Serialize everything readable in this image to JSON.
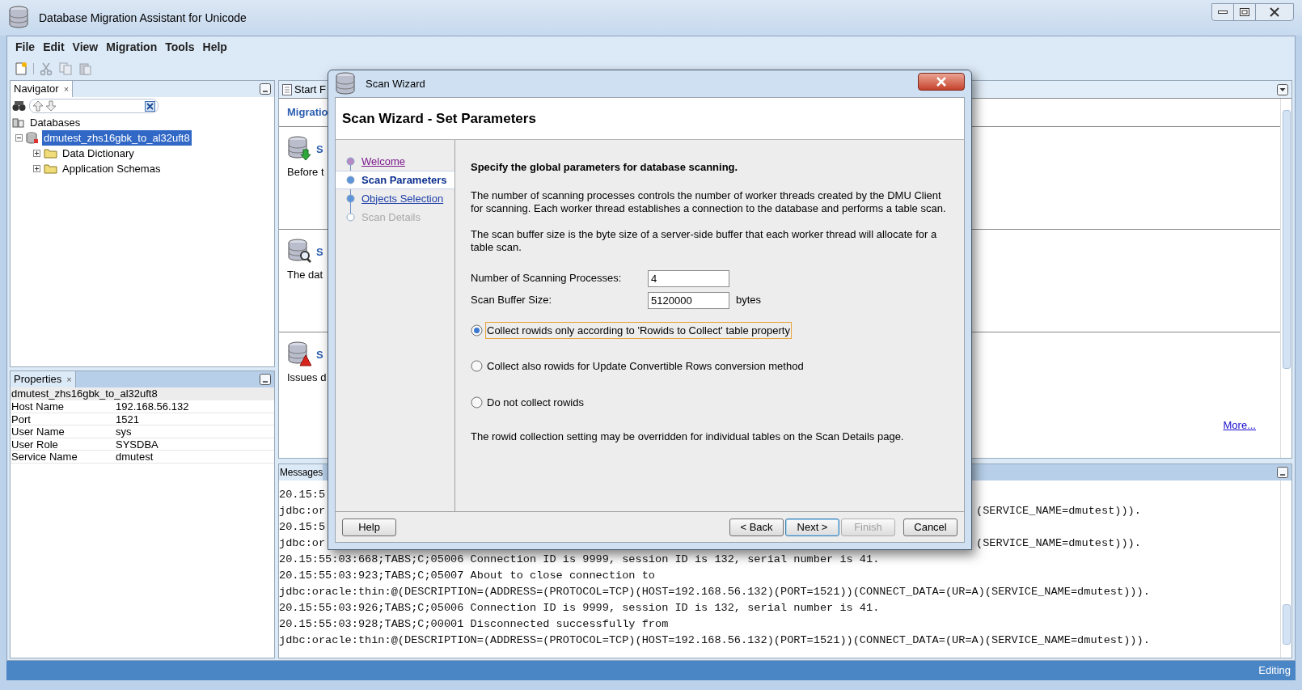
{
  "window": {
    "title": "Database Migration Assistant for Unicode"
  },
  "menu": [
    "File",
    "Edit",
    "View",
    "Migration",
    "Tools",
    "Help"
  ],
  "toolbar": [
    {
      "kind": "new",
      "disabled": false
    },
    {
      "kind": "cut",
      "disabled": true
    },
    {
      "kind": "copy",
      "disabled": true
    },
    {
      "kind": "paste",
      "disabled": true
    }
  ],
  "navigator": {
    "title": "Navigator",
    "close": "×",
    "tree": [
      {
        "label": "Databases",
        "kind": "root",
        "selected": false,
        "expanded": true,
        "children": [
          {
            "label": "dmutest_zhs16gbk_to_al32uft8",
            "kind": "database",
            "selected": true,
            "expanded": true,
            "children": [
              {
                "label": "Data Dictionary",
                "kind": "folder",
                "selected": false,
                "expanded": false
              },
              {
                "label": "Application Schemas",
                "kind": "folder",
                "selected": false,
                "expanded": false
              }
            ]
          }
        ]
      }
    ]
  },
  "properties": {
    "title": "Properties",
    "close": "×",
    "heading": "dmutest_zhs16gbk_to_al32uft8",
    "rows": [
      {
        "name": "Host Name",
        "value": "192.168.56.132"
      },
      {
        "name": "Port",
        "value": "1521"
      },
      {
        "name": "User Name",
        "value": "sys"
      },
      {
        "name": "User Role",
        "value": "SYSDBA"
      },
      {
        "name": "Service Name",
        "value": "dmutest"
      }
    ]
  },
  "start_page": {
    "tab": "Start F",
    "heading": "Migratio",
    "sections": [
      {
        "kind": "convert",
        "title": "S",
        "text": "Before t"
      },
      {
        "kind": "scan",
        "title": "S",
        "text": "The dat"
      },
      {
        "kind": "issues",
        "title": "S",
        "text": "Issues d"
      }
    ],
    "more_link": "More..."
  },
  "messages": {
    "title": "Messages",
    "lines": [
      {
        "left": "20.15:5"
      },
      {
        "left": "jdbc:or",
        "right": "(SERVICE_NAME=dmutest)))."
      },
      {
        "left": "20.15:5"
      },
      {
        "left": "jdbc:or",
        "right": "(SERVICE_NAME=dmutest)))."
      },
      {
        "left": "20.15:55:03:668;TABS;C;05006 Connection ID is 9999, session ID is 132, serial number is 41."
      },
      {
        "left": "20.15:55:03:923;TABS;C;05007 About to close connection to"
      },
      {
        "left": "jdbc:oracle:thin:@(DESCRIPTION=(ADDRESS=(PROTOCOL=TCP)(HOST=192.168.56.132)(PORT=1521))(CONNECT_DATA=(UR=A)(SERVICE_NAME=dmutest)))."
      },
      {
        "left": "20.15:55:03:926;TABS;C;05006 Connection ID is 9999, session ID is 132, serial number is 41."
      },
      {
        "left": "20.15:55:03:928;TABS;C;00001 Disconnected successfully from"
      },
      {
        "left": "jdbc:oracle:thin:@(DESCRIPTION=(ADDRESS=(PROTOCOL=TCP)(HOST=192.168.56.132)(PORT=1521))(CONNECT_DATA=(UR=A)(SERVICE_NAME=dmutest)))."
      }
    ]
  },
  "status_bar": {
    "text": "Editing"
  },
  "dialog": {
    "title": "Scan Wizard",
    "heading": "Scan Wizard - Set Parameters",
    "steps": [
      {
        "label": "Welcome",
        "kind": "visited",
        "selected": false
      },
      {
        "label": "Scan Parameters",
        "kind": "current",
        "selected": true
      },
      {
        "label": "Objects Selection",
        "kind": "link",
        "selected": false
      },
      {
        "label": "Scan Details",
        "kind": "disabled",
        "selected": false
      }
    ],
    "intro": "Specify the global parameters for database scanning.",
    "paragraphs": [
      "The number of scanning processes controls the number of worker threads created by the DMU Client for scanning. Each worker thread establishes a connection to the database and performs a table scan.",
      "The scan buffer size is the byte size of a server-side buffer that each worker thread will allocate for a table scan."
    ],
    "fields": [
      {
        "label": "Number of Scanning Processes:",
        "value": "4"
      },
      {
        "label": "Scan Buffer Size:",
        "value": "5120000",
        "unit": "bytes"
      }
    ],
    "options": [
      {
        "label": "Collect rowids only according to 'Rowids to Collect' table property",
        "selected": true,
        "focused": true
      },
      {
        "label": "Collect also rowids for Update Convertible Rows conversion method",
        "selected": false,
        "focused": false
      },
      {
        "label": "Do not collect rowids",
        "selected": false,
        "focused": false
      }
    ],
    "note": "The rowid collection setting may be overridden for individual tables on the Scan Details page.",
    "buttons": [
      {
        "label": "Help",
        "kind": "help",
        "disabled": false,
        "default": false
      },
      {
        "label": "< Back",
        "kind": "nav",
        "disabled": false,
        "default": false
      },
      {
        "label": "Next >",
        "kind": "nav",
        "disabled": false,
        "default": true
      },
      {
        "label": "Finish",
        "kind": "nav",
        "disabled": true,
        "default": false
      },
      {
        "label": "Cancel",
        "kind": "cancel",
        "disabled": false,
        "default": false
      }
    ]
  }
}
